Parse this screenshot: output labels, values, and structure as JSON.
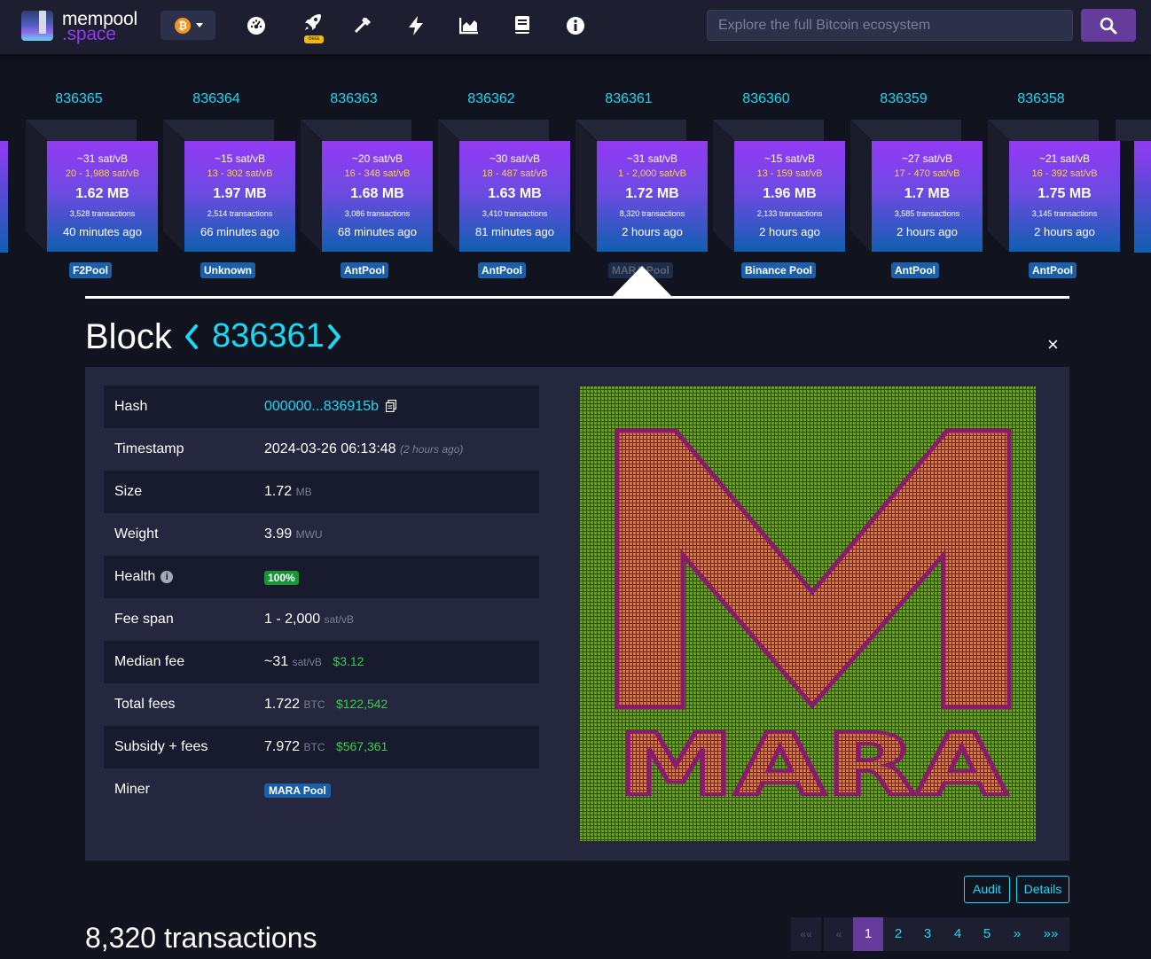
{
  "nav": {
    "logo_line1": "mempool",
    "logo_line2": ".space",
    "beta_label": "beta",
    "search_placeholder": "Explore the full Bitcoin ecosystem",
    "icons": [
      "dashboard-icon",
      "rocket-icon",
      "hammer-icon",
      "lightning-icon",
      "chart-icon",
      "book-icon",
      "info-icon"
    ]
  },
  "blocks": [
    {
      "height": "836365",
      "fee": "~31 sat/vB",
      "range": "20 - 1,988 sat/vB",
      "size": "1.62 MB",
      "txs": "3,528 transactions",
      "time": "40 minutes ago",
      "pool": "F2Pool"
    },
    {
      "height": "836364",
      "fee": "~15 sat/vB",
      "range": "13 - 302 sat/vB",
      "size": "1.97 MB",
      "txs": "2,514 transactions",
      "time": "66 minutes ago",
      "pool": "Unknown"
    },
    {
      "height": "836363",
      "fee": "~20 sat/vB",
      "range": "16 - 348 sat/vB",
      "size": "1.68 MB",
      "txs": "3,086 transactions",
      "time": "68 minutes ago",
      "pool": "AntPool"
    },
    {
      "height": "836362",
      "fee": "~30 sat/vB",
      "range": "18 - 487 sat/vB",
      "size": "1.63 MB",
      "txs": "3,410 transactions",
      "time": "81 minutes ago",
      "pool": "AntPool"
    },
    {
      "height": "836361",
      "fee": "~31 sat/vB",
      "range": "1 - 2,000 sat/vB",
      "size": "1.72 MB",
      "txs": "8,320 transactions",
      "time": "2 hours ago",
      "pool": "MARA Pool"
    },
    {
      "height": "836360",
      "fee": "~15 sat/vB",
      "range": "13 - 159 sat/vB",
      "size": "1.96 MB",
      "txs": "2,133 transactions",
      "time": "2 hours ago",
      "pool": "Binance Pool"
    },
    {
      "height": "836359",
      "fee": "~27 sat/vB",
      "range": "17 - 470 sat/vB",
      "size": "1.7 MB",
      "txs": "3,585 transactions",
      "time": "2 hours ago",
      "pool": "AntPool"
    },
    {
      "height": "836358",
      "fee": "~21 sat/vB",
      "range": "16 - 392 sat/vB",
      "size": "1.75 MB",
      "txs": "3,145 transactions",
      "time": "2 hours ago",
      "pool": "AntPool"
    }
  ],
  "block": {
    "title": "Block",
    "number": "836361",
    "close": "×"
  },
  "details": [
    {
      "label": "Hash",
      "value": "000000...836915b"
    },
    {
      "label": "Timestamp",
      "value": "2024-03-26 06:13:48",
      "ago": "(2 hours ago)"
    },
    {
      "label": "Size",
      "value": "1.72",
      "unit": "MB"
    },
    {
      "label": "Weight",
      "value": "3.99",
      "unit": "MWU"
    },
    {
      "label": "Health",
      "badge": "100%"
    },
    {
      "label": "Fee span",
      "value": "1 - 2,000",
      "unit": "sat/vB"
    },
    {
      "label": "Median fee",
      "value": "~31",
      "unit": "sat/vB",
      "fiat": "$3.12"
    },
    {
      "label": "Total fees",
      "value": "1.722",
      "unit": "BTC",
      "fiat": "$122,542"
    },
    {
      "label": "Subsidy + fees",
      "value": "7.972",
      "unit": "BTC",
      "fiat": "$567,361"
    },
    {
      "label": "Miner",
      "badge": "MARA Pool"
    }
  ],
  "viz_logo_text": "MARA",
  "buttons": {
    "audit": "Audit",
    "details": "Details"
  },
  "transactions_heading": "8,320 transactions",
  "pagination": {
    "first": "««",
    "prev": "«",
    "pages": [
      "1",
      "2",
      "3",
      "4",
      "5"
    ],
    "next": "»",
    "last": "»»",
    "active": "1"
  },
  "colors": {
    "accent_cyan": "#1bd8f4",
    "brand_purple": "#9339f4",
    "fiat_green": "#3bcc49",
    "pool_blue": "#1a5fa8"
  }
}
